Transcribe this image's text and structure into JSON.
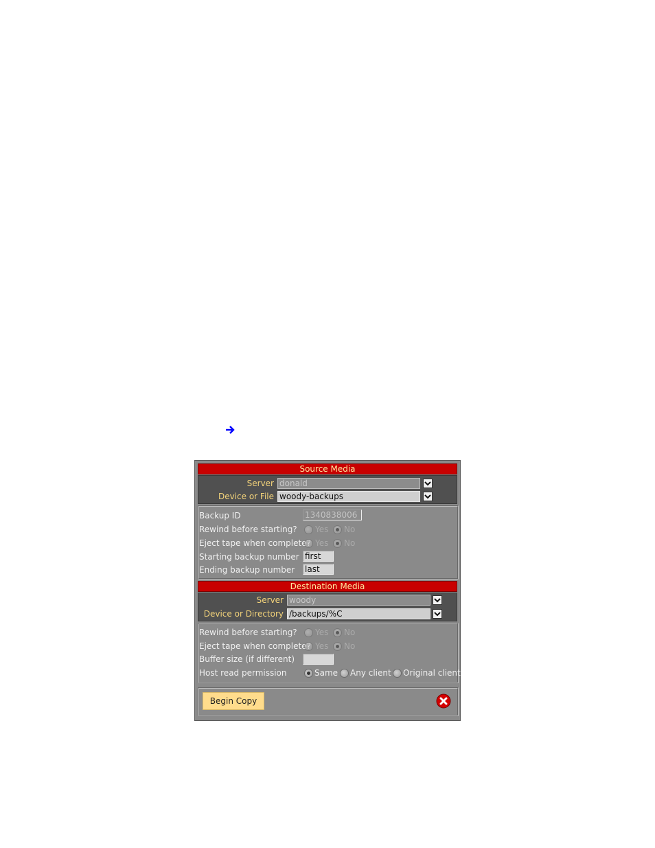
{
  "nav": {
    "arrow_icon": "arrow-right-icon",
    "arrow_color": "#0000ff"
  },
  "source": {
    "title": "Source Media",
    "server_label": "Server",
    "server_value": "donald",
    "device_label": "Device or File",
    "device_value": "woody-backups",
    "backup_id_label": "Backup ID",
    "backup_id_value": "1340838006",
    "rewind_label": "Rewind before starting?",
    "eject_label": "Eject tape when complete?",
    "yes_label": "Yes",
    "no_label": "No",
    "start_label": "Starting backup number",
    "start_value": "first",
    "end_label": "Ending backup number",
    "end_value": "last"
  },
  "destination": {
    "title": "Destination Media",
    "server_label": "Server",
    "server_value": "woody",
    "device_label": "Device or Directory",
    "device_value": "/backups/%C",
    "rewind_label": "Rewind before starting?",
    "eject_label": "Eject tape when complete?",
    "yes_label": "Yes",
    "no_label": "No",
    "buffer_label": "Buffer size (if different)",
    "buffer_value": "",
    "perm_label": "Host read permission",
    "perm_same": "Same",
    "perm_any": "Any client",
    "perm_orig": "Original client"
  },
  "footer": {
    "begin_label": "Begin Copy",
    "close_icon": "close-icon"
  },
  "colors": {
    "title_bar": "#c80000",
    "title_text": "#ffe9a0",
    "label_yellow": "#f3d37a",
    "panel_bg": "#8a8a8a",
    "button_bg": "#ffdc8c"
  }
}
